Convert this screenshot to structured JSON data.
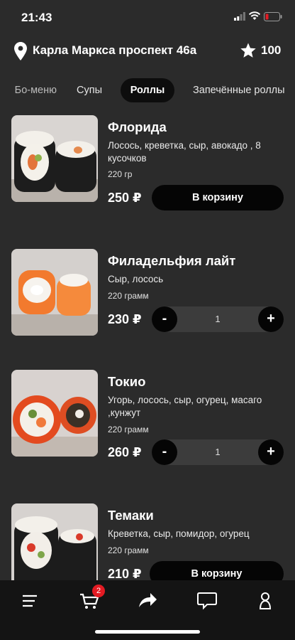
{
  "status": {
    "time": "21:43"
  },
  "header": {
    "address": "Карла Маркса проспект 46а",
    "points": "100"
  },
  "tabs": [
    {
      "label": "Бо-меню"
    },
    {
      "label": "Супы"
    },
    {
      "label": "Роллы",
      "active": true
    },
    {
      "label": "Запечённые роллы"
    }
  ],
  "products": [
    {
      "name": "Флорида",
      "desc": "Лосось, креветка, сыр, авокадо , 8 кусочков",
      "weight": "220 гр",
      "price": "250 ₽",
      "button": "В корзину"
    },
    {
      "name": "Филадельфия лайт",
      "desc": "Сыр, лосось",
      "weight": "220 грамм",
      "price": "230 ₽",
      "minus": "-",
      "qty": "1",
      "plus": "+"
    },
    {
      "name": "Токио",
      "desc": "Угорь, лосось, сыр, огурец, масаго ,кунжут",
      "weight": "220 грамм",
      "price": "260 ₽",
      "minus": "-",
      "qty": "1",
      "plus": "+"
    },
    {
      "name": "Темаки",
      "desc": "Креветка, сыр, помидор, огурец",
      "weight": "220 грамм",
      "price": "210 ₽",
      "button": "В корзину"
    }
  ],
  "nav": {
    "cart_badge": "2"
  },
  "colors": {
    "background": "#2b2b2b",
    "button": "#050505",
    "badge": "#e31b23"
  }
}
